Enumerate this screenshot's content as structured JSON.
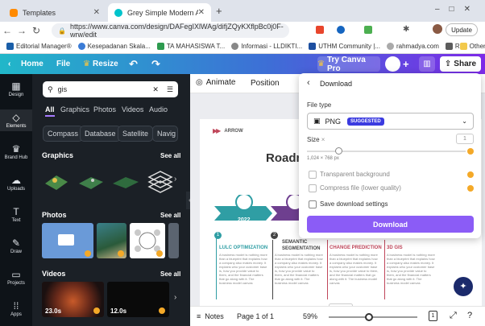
{
  "browser": {
    "tabs": [
      {
        "title": "Templates",
        "favicon_color": "#ff8a00"
      },
      {
        "title": "Grey Simple Modern Arrow Step",
        "favicon_color": "#00c4cc"
      }
    ],
    "new_tab": "+",
    "url": "https://www.canva.com/design/DAFegIXlWAg/difjZQyKXflpBc0j0F-wrw/edit",
    "update_label": "Update",
    "bookmarks": [
      "Editorial Manager®",
      "Kesepadanan Skala...",
      "TA MAHASISWA T...",
      "Informasi - LLDIKTI...",
      "UTHM Community |...",
      "rahmadya.com",
      "R"
    ],
    "other_bookmarks": "Other bookmarks"
  },
  "canva": {
    "home": "Home",
    "file": "File",
    "resize": "Resize",
    "try_pro": "Try Canva Pro",
    "share": "Share",
    "rail": [
      {
        "label": "Design",
        "icon": "layout-icon"
      },
      {
        "label": "Elements",
        "icon": "shapes-icon"
      },
      {
        "label": "Brand Hub",
        "icon": "crown-icon"
      },
      {
        "label": "Uploads",
        "icon": "cloud-upload-icon"
      },
      {
        "label": "Text",
        "icon": "text-icon"
      },
      {
        "label": "Draw",
        "icon": "pen-icon"
      },
      {
        "label": "Projects",
        "icon": "folder-icon"
      },
      {
        "label": "Apps",
        "icon": "apps-icon"
      }
    ],
    "search": {
      "value": "gis"
    },
    "panel_tabs": [
      "All",
      "Graphics",
      "Photos",
      "Videos",
      "Audio"
    ],
    "chips": [
      "Compass",
      "Database",
      "Satellite",
      "Navig"
    ],
    "sections": {
      "graphics": "Graphics",
      "photos": "Photos",
      "videos": "Videos",
      "see_all": "See all"
    },
    "video_durations": [
      "23.0s",
      "12.0s"
    ],
    "toolbar": {
      "animate": "Animate",
      "position": "Position"
    },
    "bottom": {
      "notes": "Notes",
      "page": "Page 1 of 1",
      "zoom": "59%",
      "page_count": "1"
    }
  },
  "design": {
    "arrow": "ARROW",
    "title": "Roadm",
    "steps": [
      {
        "year": "2022",
        "color": "#2f9ea4"
      },
      {
        "year": "",
        "color": "#6e3f8f"
      }
    ],
    "cols": [
      {
        "num": "1",
        "head": "LULC OPTIMIZATION",
        "color": "#2f9ea4"
      },
      {
        "num": "2",
        "head": "SEMANTIC SEGMENTATION",
        "color": "#444"
      },
      {
        "num": "",
        "head": "CHANGE PREDICTION",
        "color": "#c0465a"
      },
      {
        "num": "",
        "head": "3D GIS",
        "color": "#c0465a"
      }
    ],
    "body": "A business model is nothing more than a blueprint that explains how a company also makes money. It explains who your customer base is, how you provide value to them, and the financial matters that go along with it. The business model canvas"
  },
  "download": {
    "title": "Download",
    "file_type_label": "File type",
    "file_type": "PNG",
    "badge": "SUGGESTED",
    "size_label": "Size",
    "size_value": "1",
    "dimensions": "1,024 × 768 px",
    "transparent": "Transparent background",
    "compress": "Compress file (lower quality)",
    "save_settings": "Save download settings",
    "button": "Download"
  },
  "colors": {
    "purple": "#8b3dff",
    "teal": "#21b7c9",
    "suggested": "#3b3be0",
    "crown": "#f4a928"
  }
}
